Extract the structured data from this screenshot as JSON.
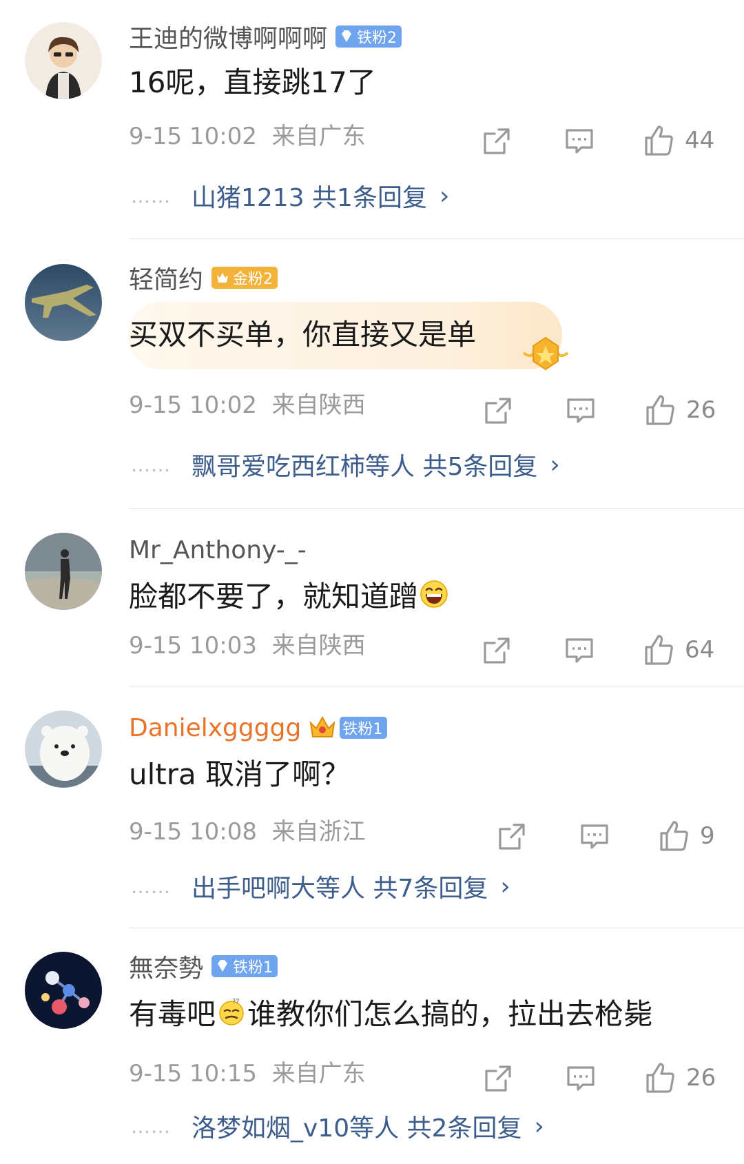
{
  "comments": [
    {
      "username": "王迪的微博啊啊啊",
      "badge": "铁粉2",
      "badge_color": "#6fa4ee",
      "text": "16呢，直接跳17了",
      "time": "9-15 10:02",
      "location": "来自广东",
      "likes": "44",
      "replies": "山猪1213  共1条回复"
    },
    {
      "username": "轻简约",
      "badge": "金粉2",
      "badge_color": "#f3b33a",
      "text": "买双不买单，你直接又是单",
      "time": "9-15 10:02",
      "location": "来自陕西",
      "likes": "26",
      "replies": "飘哥爱吃西红柿等人  共5条回复"
    },
    {
      "username": "Mr_Anthony-_-",
      "text_before": "脸都不要了，就知道蹭",
      "emoji": "laughing-emoji",
      "time": "9-15 10:03",
      "location": "来自陕西",
      "likes": "64"
    },
    {
      "username": "Danielxggggg",
      "username_color": "#e8742a",
      "badge": "铁粉1",
      "badge_color": "#6fa4ee",
      "text": "ultra 取消了啊？",
      "time": "9-15 10:08",
      "location": "来自浙江",
      "likes": "9",
      "replies": "出手吧啊大等人  共7条回复"
    },
    {
      "username": "無奈勢",
      "badge": "铁粉1",
      "badge_color": "#6fa4ee",
      "text_before": "有毒吧",
      "emoji": "dizzy-emoji",
      "text_after": "谁教你们怎么搞的，拉出去枪毙",
      "time": "9-15 10:15",
      "location": "来自广东",
      "likes": "26",
      "replies": "洛梦如烟_v10等人  共2条回复"
    }
  ],
  "reply_dots": "……",
  "chevron": "›"
}
